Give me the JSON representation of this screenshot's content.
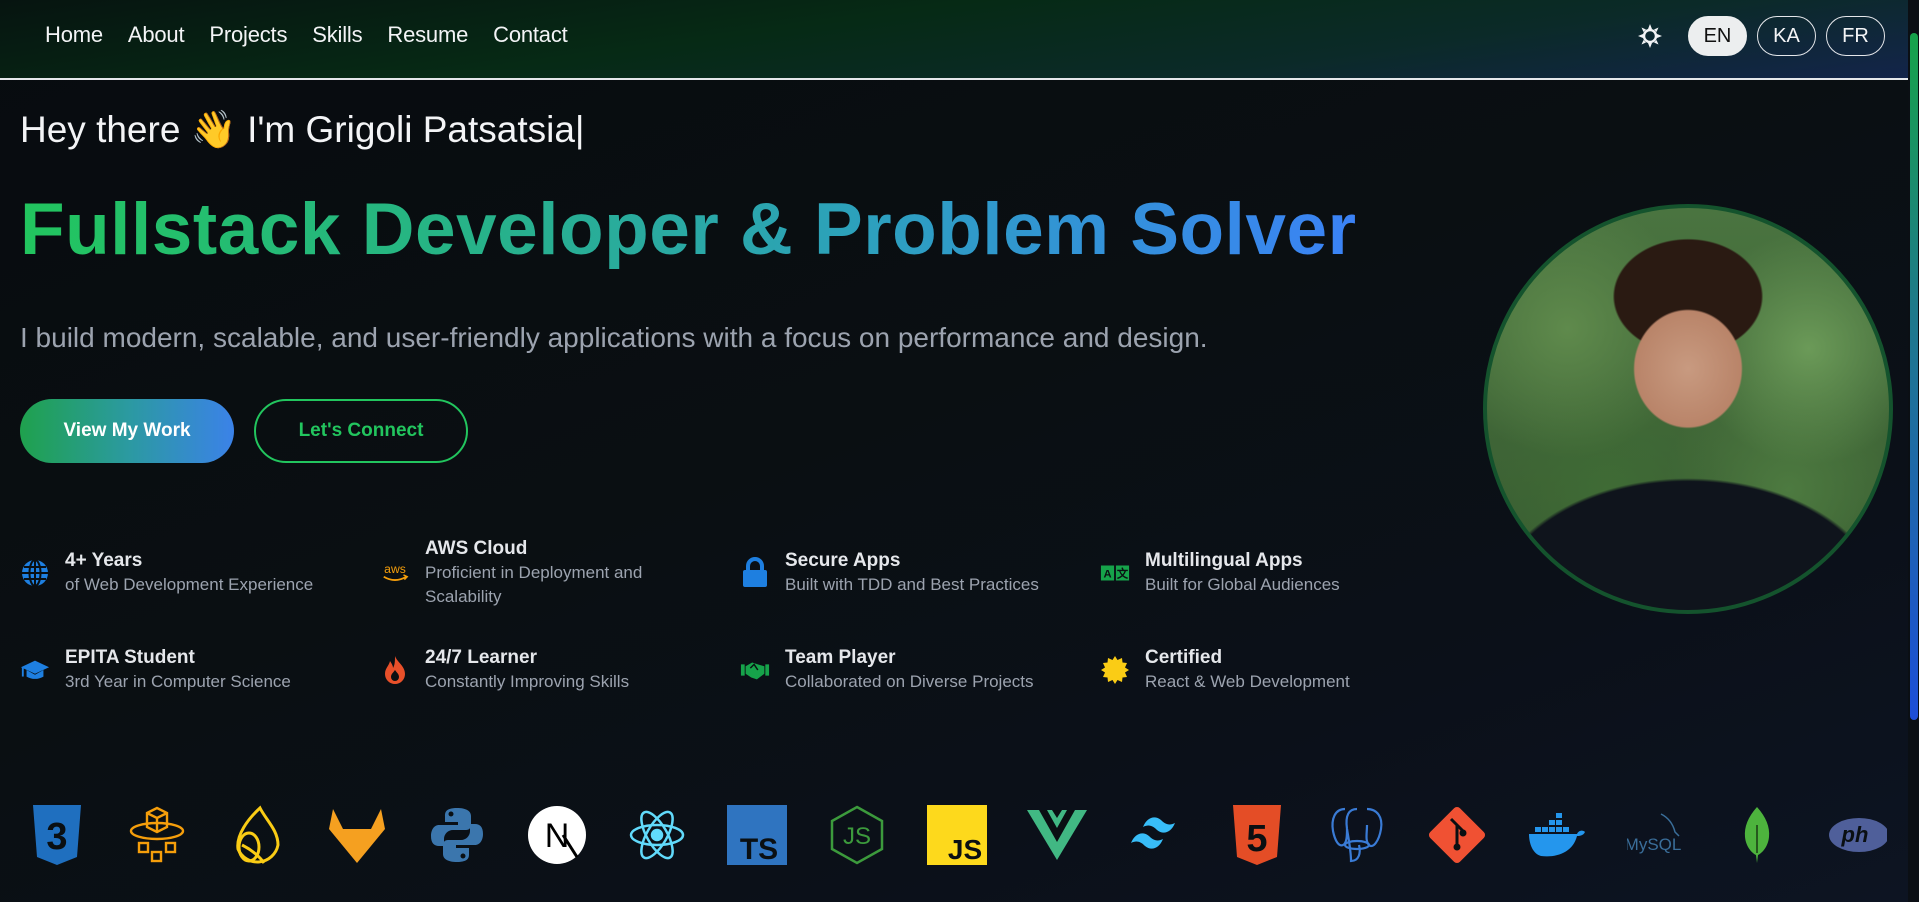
{
  "nav": {
    "links": [
      "Home",
      "About",
      "Projects",
      "Skills",
      "Resume",
      "Contact"
    ],
    "theme_icon": "sun-icon",
    "languages": [
      {
        "code": "EN",
        "active": true
      },
      {
        "code": "KA",
        "active": false
      },
      {
        "code": "FR",
        "active": false
      }
    ]
  },
  "hero": {
    "greeting": "Hey there",
    "wave_emoji": "👋",
    "name_line": "I'm Grigoli Patsatsia",
    "caret": "|",
    "headline": "Fullstack Developer & Problem Solver",
    "subtitle": "I build modern, scalable, and user-friendly applications with a focus on performance and design.",
    "primary_button": "View My Work",
    "secondary_button": "Let's Connect",
    "profile_alt": "Grigoli Patsatsia portrait"
  },
  "features": [
    {
      "icon": "globe-icon",
      "title": "4+ Years",
      "desc": "of Web Development Experience",
      "color": "#1e7fe0"
    },
    {
      "icon": "aws-icon",
      "title": "AWS Cloud",
      "desc": "Proficient in Deployment and Scalability",
      "color": "#f59e0b"
    },
    {
      "icon": "lock-icon",
      "title": "Secure Apps",
      "desc": "Built with TDD and Best Practices",
      "color": "#1e7fe0"
    },
    {
      "icon": "translate-icon",
      "title": "Multilingual Apps",
      "desc": "Built for Global Audiences",
      "color": "#16a34a"
    },
    {
      "icon": "graduation-cap-icon",
      "title": "EPITA Student",
      "desc": "3rd Year in Computer Science",
      "color": "#1e7fe0"
    },
    {
      "icon": "fire-icon",
      "title": "24/7 Learner",
      "desc": "Constantly Improving Skills",
      "color": "#e8502a"
    },
    {
      "icon": "handshake-icon",
      "title": "Team Player",
      "desc": "Collaborated on Diverse Projects",
      "color": "#16a34a"
    },
    {
      "icon": "badge-icon",
      "title": "Certified",
      "desc": "React & Web Development",
      "color": "#facc15"
    }
  ],
  "tech_stack": [
    {
      "name": "css3-icon",
      "label": "3"
    },
    {
      "name": "aws-amplify-icon",
      "label": ""
    },
    {
      "name": "sentry-icon",
      "label": ""
    },
    {
      "name": "gitlab-icon",
      "label": ""
    },
    {
      "name": "python-icon",
      "label": ""
    },
    {
      "name": "nextjs-icon",
      "label": "N"
    },
    {
      "name": "react-icon",
      "label": ""
    },
    {
      "name": "typescript-icon",
      "label": "TS"
    },
    {
      "name": "nodejs-icon",
      "label": "JS"
    },
    {
      "name": "javascript-icon",
      "label": "JS"
    },
    {
      "name": "vue-icon",
      "label": ""
    },
    {
      "name": "tailwind-icon",
      "label": ""
    },
    {
      "name": "html5-icon",
      "label": "5"
    },
    {
      "name": "postgresql-icon",
      "label": ""
    },
    {
      "name": "git-icon",
      "label": ""
    },
    {
      "name": "docker-icon",
      "label": ""
    },
    {
      "name": "mysql-icon",
      "label": "MySQL"
    },
    {
      "name": "mongodb-icon",
      "label": ""
    },
    {
      "name": "php-icon",
      "label": "ph"
    }
  ],
  "colors": {
    "accent_green": "#22c55e",
    "accent_blue": "#3b82f6"
  }
}
